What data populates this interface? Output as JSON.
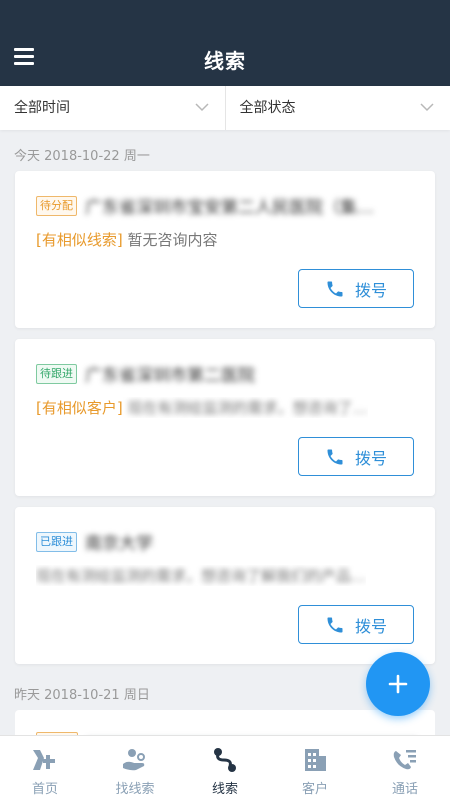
{
  "header": {
    "title": "线索"
  },
  "filters": {
    "time": "全部时间",
    "status": "全部状态"
  },
  "sections": [
    {
      "date": "今天 2018-10-22 周一"
    },
    {
      "date": "昨天 2018-10-21 周日"
    }
  ],
  "cards": [
    {
      "tag": "待分配",
      "title": "广东省深圳市宝安第二人民医院（集…",
      "similar": "[有相似线索]",
      "desc": "暂无咨询内容",
      "dial": "拨号"
    },
    {
      "tag": "待跟进",
      "title": "广东省深圳市第二医院",
      "similar": "[有相似客户]",
      "desc": "现在有测绘监测的需求，想咨询了…",
      "dial": "拨号"
    },
    {
      "tag": "已跟进",
      "title": "南京大学",
      "similar": "",
      "desc": "现在有测绘监测的需求，想咨询了解我们的产品…",
      "dial": "拨号"
    }
  ],
  "tabs": [
    {
      "label": "首页"
    },
    {
      "label": "找线索"
    },
    {
      "label": "线索"
    },
    {
      "label": "客户"
    },
    {
      "label": "通话"
    }
  ],
  "colors": {
    "header_bg": "#253445",
    "accent": "#2196f3",
    "orange": "#e89a2c",
    "green": "#35a86b",
    "blue": "#2f8fd8"
  }
}
